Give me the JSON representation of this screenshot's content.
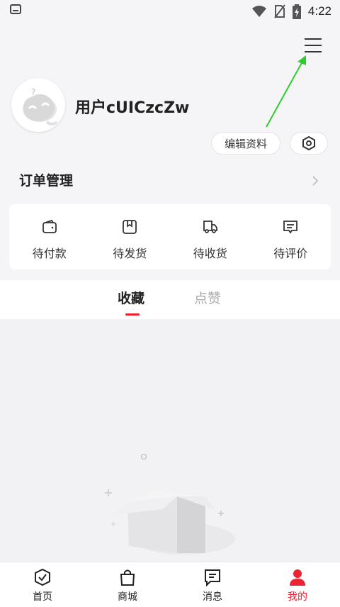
{
  "status_bar": {
    "time": "4:22"
  },
  "profile": {
    "username": "用户cUICzcZw",
    "edit_label": "编辑资料"
  },
  "orders": {
    "title": "订单管理",
    "items": [
      {
        "label": "待付款",
        "icon": "wallet-icon"
      },
      {
        "label": "待发货",
        "icon": "package-icon"
      },
      {
        "label": "待收货",
        "icon": "truck-icon"
      },
      {
        "label": "待评价",
        "icon": "comment-icon"
      }
    ]
  },
  "tabs": [
    {
      "label": "收藏",
      "active": true
    },
    {
      "label": "点赞",
      "active": false
    }
  ],
  "tabbar": [
    {
      "label": "首页",
      "icon": "home-check-icon",
      "active": false
    },
    {
      "label": "商城",
      "icon": "shopping-bag-icon",
      "active": false
    },
    {
      "label": "消息",
      "icon": "message-icon",
      "active": false
    },
    {
      "label": "我的",
      "icon": "user-icon",
      "active": true
    }
  ],
  "colors": {
    "accent": "#ee2233",
    "annotation_arrow": "#2ecc2e"
  }
}
